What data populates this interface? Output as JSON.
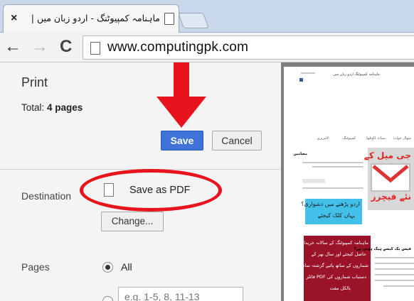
{
  "browser": {
    "tab_title": "ماہنامہ کمپیوٹنگ - اردو زبان میں |",
    "tab_close": "×",
    "nav_back": "←",
    "nav_forward": "→",
    "nav_reload": "C",
    "url": "www.computingpk.com"
  },
  "print_panel": {
    "title": "Print",
    "total_prefix": "Total: ",
    "total_value": "4 pages",
    "save_label": "Save",
    "cancel_label": "Cancel",
    "destination_label": "Destination",
    "destination_value": "Save as PDF",
    "change_label": "Change...",
    "pages_label": "Pages",
    "pages_all_label": "All",
    "pages_range_placeholder": "e.g. 1-5, 8, 11-13"
  },
  "colors": {
    "annotation_red": "#e8141b",
    "save_blue": "#3f73d8",
    "preview_background": "#7f7f7f"
  },
  "preview": {
    "header_urdu": "ماہنامہ کمپیوٹنگ اردو زبان میں",
    "nav_items": [
      "سوال جواب",
      "سیاٹ ڈاؤنلوڈ",
      "کمپیوٹنگ",
      "لائبریری"
    ],
    "sidebar_title": "مضامین",
    "gmail_text_1": "جی میل کے",
    "gmail_text_2": "نئے فیچرز",
    "banner_text_1": "اردو پڑھنے میں دشواری؟",
    "banner_text_2": "یہاں کلک کیجئے",
    "promo_lines": [
      "ماہنامہ کمپیوٹنگ کے سالانہ خریدار",
      "حاصل کیجئے اور سال بھر کے",
      "شماروں کے ساتھ پائیے گزشتہ تمام",
      "دستیاب شماروں کی PDF فائلز",
      "بالکل مفت"
    ],
    "article_title": "فیس بک کیسے ہیک ہوتی ہے؟"
  }
}
